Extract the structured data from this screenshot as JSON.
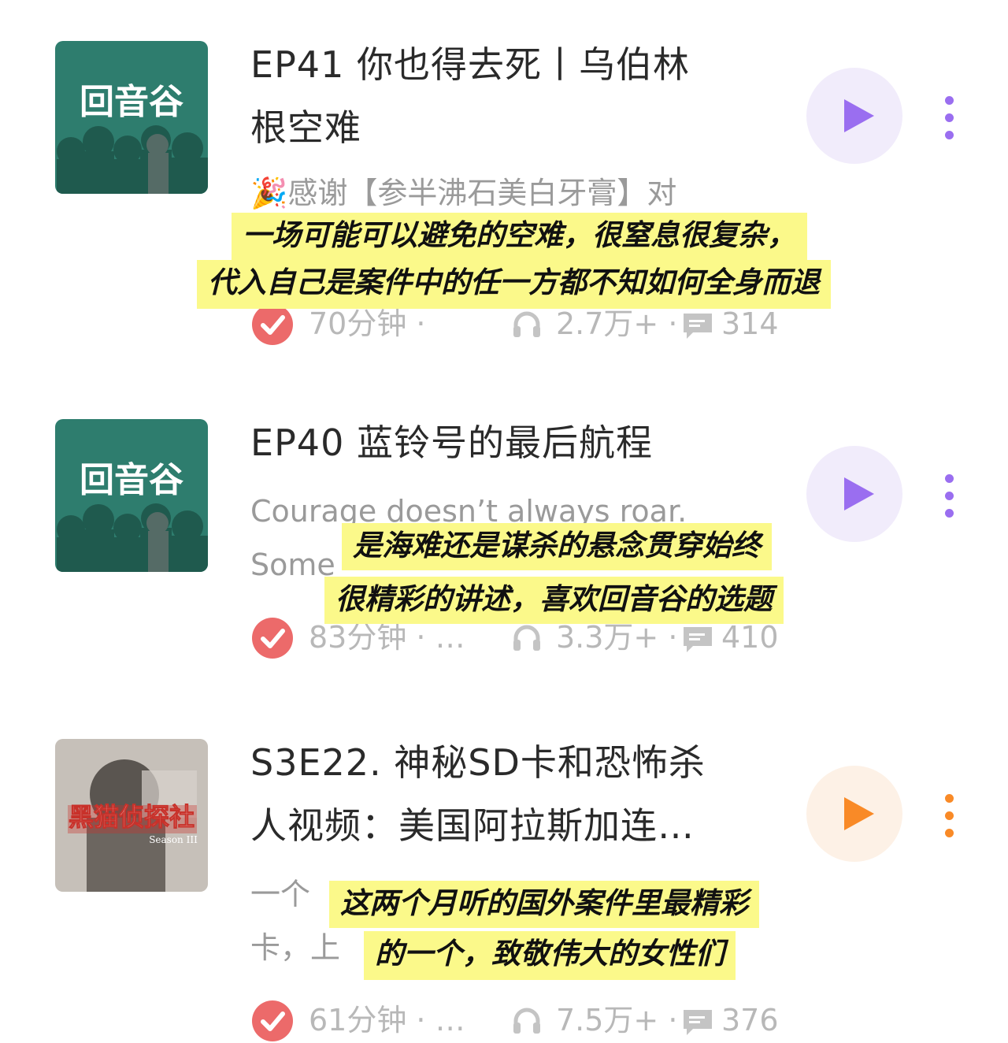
{
  "colors": {
    "cover_teal": "#2e7d6e",
    "play_purple": "#9a6ef0",
    "play_purple_bg": "#f1ecfb",
    "play_orange": "#f98a27",
    "play_orange_bg": "#fdf1e6",
    "check_red": "#ec6a6a",
    "highlight_yellow": "#fbf98a"
  },
  "episodes": [
    {
      "cover_label": "回音谷",
      "title_line1": "EP41 你也得去死丨乌伯林",
      "title_line2": "根空难",
      "desc_line1": "🎉感谢【参半沸石美白牙膏】对",
      "desc_line2": "",
      "duration": "70分钟 ·",
      "plays": "2.7万+ ·",
      "comments": "314",
      "play_icon": "play-icon",
      "more_icon": "more-vertical-icon",
      "overlay_line1": "一场可能可以避免的空难，很窒息很复杂，",
      "overlay_line2": "代入自己是案件中的任一方都不知如何全身而退"
    },
    {
      "cover_label": "回音谷",
      "title_line1": "EP40 蓝铃号的最后航程",
      "title_line2": "",
      "desc_line1": "Courage doesn’t always roar.",
      "desc_line2": "Some",
      "duration": "83分钟 · …",
      "plays": "3.3万+ ·",
      "comments": "410",
      "play_icon": "play-icon",
      "more_icon": "more-vertical-icon",
      "overlay_line1": "是海难还是谋杀的悬念贯穿始终",
      "overlay_line2": "很精彩的讲述，喜欢回音谷的选题"
    },
    {
      "cover_label": "黑猫侦探社",
      "cover_sublabel": "Season III",
      "title_line1": "S3E22. 神秘SD卡和恐怖杀",
      "title_line2": "人视频：美国阿拉斯加连…",
      "desc_line1": "一个",
      "desc_line2": "卡，上",
      "duration": "61分钟 · …",
      "plays": "7.5万+ ·",
      "comments": "376",
      "play_icon": "play-icon",
      "more_icon": "more-vertical-icon",
      "overlay_line1": "这两个月听的国外案件里最精彩",
      "overlay_line2": "的一个，致敬伟大的女性们"
    }
  ]
}
